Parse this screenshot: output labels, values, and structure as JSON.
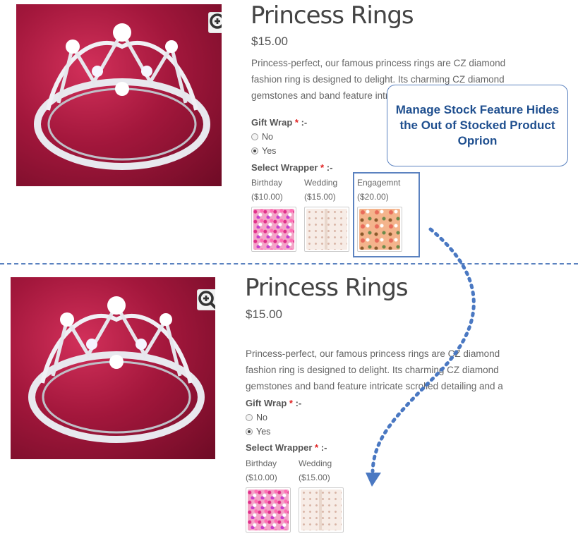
{
  "top": {
    "title": "Princess Rings",
    "price": "$15.00",
    "description": [
      "Princess-perfect, our famous princess rings are CZ diamond",
      "fashion ring is designed to delight. Its charming CZ diamond",
      "gemstones and band feature intric"
    ],
    "gift_wrap": {
      "label": "Gift Wrap",
      "required": "*",
      "suffix": ":-",
      "options": [
        "No",
        "Yes"
      ],
      "selected": "Yes"
    },
    "select_wrapper": {
      "label": "Select Wrapper",
      "required": "*",
      "suffix": ":-",
      "options": [
        {
          "name": "Birthday",
          "price": "($10.00)"
        },
        {
          "name": "Wedding",
          "price": "($15.00)"
        },
        {
          "name": "Engagemnt",
          "price": "($20.00)"
        }
      ]
    }
  },
  "bottom": {
    "title": "Princess Rings",
    "price": "$15.00",
    "description": [
      "Princess-perfect, our famous princess rings are CZ diamond",
      "fashion ring is designed to delight. Its charming CZ diamond",
      "gemstones and band feature intricate scrolled detailing and a"
    ],
    "gift_wrap": {
      "label": "Gift Wrap",
      "required": "*",
      "suffix": ":-",
      "options": [
        "No",
        "Yes"
      ],
      "selected": "Yes"
    },
    "select_wrapper": {
      "label": "Select Wrapper",
      "required": "*",
      "suffix": ":-",
      "options": [
        {
          "name": "Birthday",
          "price": "($10.00)"
        },
        {
          "name": "Wedding",
          "price": "($15.00)"
        }
      ]
    }
  },
  "callout": {
    "text": "Manage Stock Feature Hides the Out of Stocked Product Oprion"
  },
  "icons": {
    "zoom": "zoom-in-icon",
    "arrow": "dotted-arrow-down-icon"
  },
  "colors": {
    "accent": "#5b82c0",
    "callout_text": "#1f4f8f",
    "required": "#e02020",
    "ring_bg": "#a3173c"
  }
}
